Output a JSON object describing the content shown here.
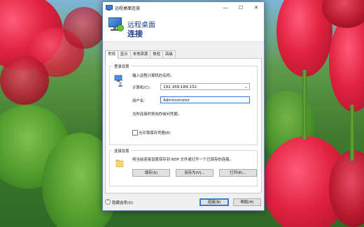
{
  "window": {
    "title": "远程桌面连接",
    "header_line1": "远程桌面",
    "header_line2": "连接",
    "controls": {
      "minimize": "—",
      "maximize": "☐",
      "close": "✕"
    }
  },
  "tabs": [
    {
      "label": "常规",
      "active": true
    },
    {
      "label": "显示",
      "active": false
    },
    {
      "label": "本地资源",
      "active": false
    },
    {
      "label": "体验",
      "active": false
    },
    {
      "label": "高级",
      "active": false
    }
  ],
  "login_settings": {
    "group_title": "登录设置",
    "hint": "输入远程计算机的名称。",
    "computer_label": "计算机(C):",
    "computer_value": "192.168.184.132",
    "username_label": "用户名:",
    "username_value": "Administrator",
    "credentials_note": "当你连接时将向你询问凭据。",
    "save_credentials_label": "允许我保存凭据(R)",
    "save_credentials_checked": false
  },
  "connection_settings": {
    "group_title": "连接设置",
    "hint": "将当前连接设置保存到 RDP 文件或打开一个已保存的连接。",
    "save_label": "保存(S)",
    "save_as_label": "另存为(V)...",
    "open_label": "打开(E)..."
  },
  "footer": {
    "hide_options_label": "隐藏选项(O)",
    "connect_label": "连接(N)",
    "help_label": "帮助(H)"
  },
  "icons": {
    "title": "remote-desktop-icon",
    "header": "remote-desktop-large-icon",
    "login": "computer-user-icon",
    "connection": "folder-icon",
    "toggle": "chevron-up-icon"
  },
  "colors": {
    "accent": "#3b7bd6",
    "header_text": "#1f3f8f",
    "window_bg": "#f0f0f0"
  }
}
